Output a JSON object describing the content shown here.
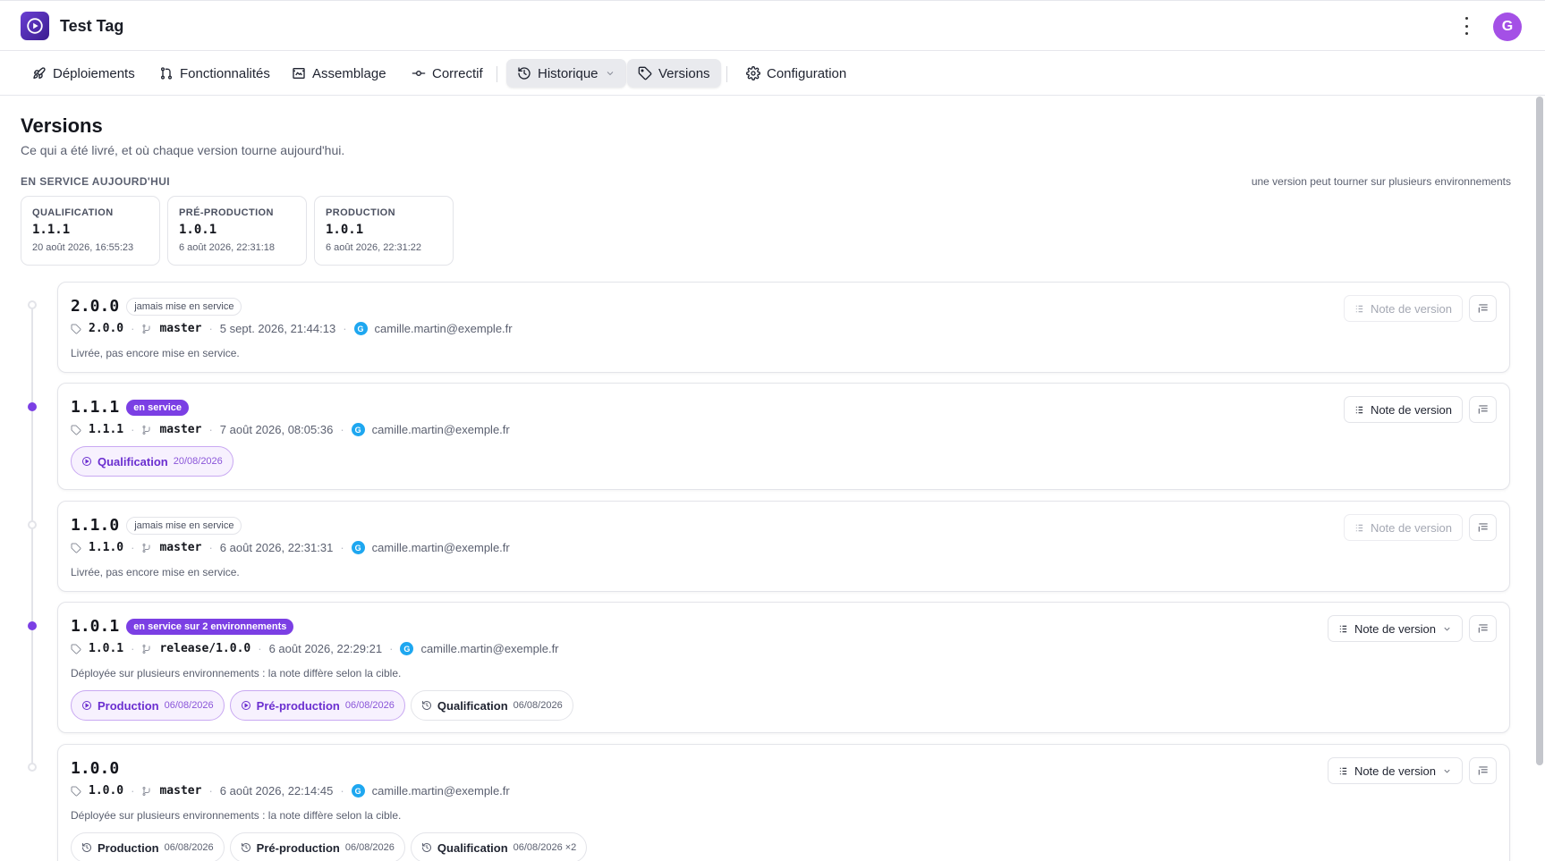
{
  "app": {
    "title": "Test Tag",
    "avatar_initial": "G",
    "brand_color": "#5b2fc4"
  },
  "nav": {
    "items": [
      {
        "label": "Déploiements",
        "icon": "rocket-icon"
      },
      {
        "label": "Fonctionnalités",
        "icon": "git-branch-icon"
      },
      {
        "label": "Assemblage",
        "icon": "assembly-icon"
      },
      {
        "label": "Correctif",
        "icon": "commit-icon"
      },
      {
        "label": "Historique",
        "icon": "history-icon"
      },
      {
        "label": "Versions",
        "icon": "tag-icon"
      },
      {
        "label": "Configuration",
        "icon": "gear-icon"
      }
    ]
  },
  "page": {
    "title": "Versions",
    "subtitle": "Ce qui a été livré, et où chaque version tourne aujourd'hui.",
    "section_label": "EN SERVICE AUJOURD'HUI",
    "section_hint": "une version peut tourner sur plusieurs environnements"
  },
  "environments": [
    {
      "name": "QUALIFICATION",
      "version": "1.1.1",
      "date": "20 août 2026, 16:55:23"
    },
    {
      "name": "PRÉ-PRODUCTION",
      "version": "1.0.1",
      "date": "6 août 2026, 22:31:18"
    },
    {
      "name": "PRODUCTION",
      "version": "1.0.1",
      "date": "6 août 2026, 22:31:22"
    }
  ],
  "note_label": "Note de version",
  "versions": [
    {
      "version": "2.0.0",
      "badge": "jamais mise en service",
      "tag": "2.0.0",
      "branch": "master",
      "date": "5 sept. 2026, 21:44:13",
      "author": "camille.martin@exemple.fr",
      "author_initial": "G",
      "description": "Livrée, pas encore mise en service.",
      "chips": []
    },
    {
      "version": "1.1.1",
      "badge": "en service",
      "tag": "1.1.1",
      "branch": "master",
      "date": "7 août 2026, 08:05:36",
      "author": "camille.martin@exemple.fr",
      "author_initial": "G",
      "description": "",
      "chips": [
        {
          "name": "Qualification",
          "date": "20/08/2026",
          "live": true
        }
      ]
    },
    {
      "version": "1.1.0",
      "badge": "jamais mise en service",
      "tag": "1.1.0",
      "branch": "master",
      "date": "6 août 2026, 22:31:31",
      "author": "camille.martin@exemple.fr",
      "author_initial": "G",
      "description": "Livrée, pas encore mise en service.",
      "chips": []
    },
    {
      "version": "1.0.1",
      "badge": "en service sur 2 environnements",
      "tag": "1.0.1",
      "branch": "release/1.0.0",
      "date": "6 août 2026, 22:29:21",
      "author": "camille.martin@exemple.fr",
      "author_initial": "G",
      "description": "Déployée sur plusieurs environnements : la note diffère selon la cible.",
      "chips": [
        {
          "name": "Production",
          "date": "06/08/2026",
          "live": true
        },
        {
          "name": "Pré-production",
          "date": "06/08/2026",
          "live": true
        },
        {
          "name": "Qualification",
          "date": "06/08/2026",
          "live": false
        }
      ]
    },
    {
      "version": "1.0.0",
      "badge": "",
      "tag": "1.0.0",
      "branch": "master",
      "date": "6 août 2026, 22:14:45",
      "author": "camille.martin@exemple.fr",
      "author_initial": "G",
      "description": "Déployée sur plusieurs environnements : la note diffère selon la cible.",
      "chips": [
        {
          "name": "Production",
          "date": "06/08/2026",
          "live": false
        },
        {
          "name": "Pré-production",
          "date": "06/08/2026",
          "live": false
        },
        {
          "name": "Qualification",
          "date": "06/08/2026 ×2",
          "live": false
        }
      ]
    }
  ]
}
